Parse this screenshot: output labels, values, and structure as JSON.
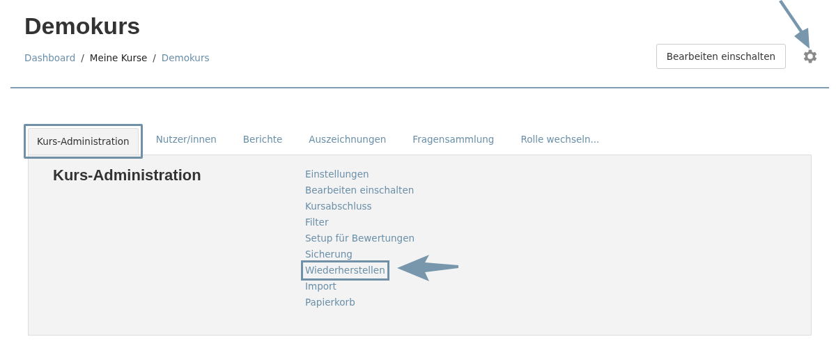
{
  "page_title": "Demokurs",
  "breadcrumb_separator": "/",
  "breadcrumb": [
    {
      "label": "Dashboard",
      "link": true
    },
    {
      "label": "Meine Kurse",
      "link": false
    },
    {
      "label": "Demokurs",
      "link": true
    }
  ],
  "edit_button": "Bearbeiten einschalten",
  "tabs": [
    {
      "label": "Kurs-Administration",
      "selected": true,
      "highlighted": true
    },
    {
      "label": "Nutzer/innen",
      "selected": false,
      "highlighted": false
    },
    {
      "label": "Berichte",
      "selected": false,
      "highlighted": false
    },
    {
      "label": "Auszeichnungen",
      "selected": false,
      "highlighted": false
    },
    {
      "label": "Fragensammlung",
      "selected": false,
      "highlighted": false
    },
    {
      "label": "Rolle wechseln...",
      "selected": false,
      "highlighted": false
    }
  ],
  "panel": {
    "heading": "Kurs-Administration",
    "links": [
      {
        "label": "Einstellungen",
        "highlighted": false
      },
      {
        "label": "Bearbeiten einschalten",
        "highlighted": false
      },
      {
        "label": "Kursabschluss",
        "highlighted": false
      },
      {
        "label": "Filter",
        "highlighted": false
      },
      {
        "label": "Setup für Bewertungen",
        "highlighted": false
      },
      {
        "label": "Sicherung",
        "highlighted": false
      },
      {
        "label": "Wiederherstellen",
        "highlighted": true
      },
      {
        "label": "Import",
        "highlighted": false
      },
      {
        "label": "Papierkorb",
        "highlighted": false
      }
    ]
  }
}
